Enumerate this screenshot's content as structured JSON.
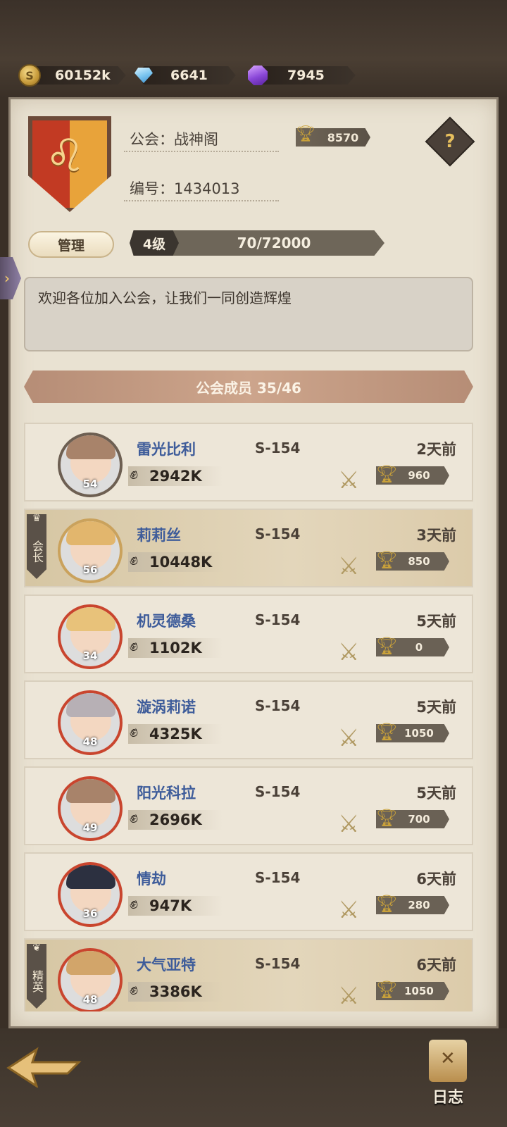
{
  "currency": {
    "gold": "60152k",
    "diamond": "6641",
    "crystal": "7945"
  },
  "guild": {
    "name_label": "公会：战神阁",
    "id_label": "编号：1434013",
    "trophies": "8570",
    "help_symbol": "?",
    "manage_label": "管理",
    "level": "4级",
    "exp": "70/72000",
    "notice": "欢迎各位加入公会，让我们一同创造辉煌"
  },
  "members_header": "公会成员 35/46",
  "members": [
    {
      "name": "雷光比利",
      "server": "S-154",
      "last_seen": "2天前",
      "power": "2942K",
      "trophies": "960",
      "level": "54",
      "badge": "",
      "hair": "#a8836a",
      "ring": "#6d5f52"
    },
    {
      "name": "莉莉丝",
      "server": "S-154",
      "last_seen": "3天前",
      "power": "10448K",
      "trophies": "850",
      "level": "56",
      "badge": "会长",
      "hair": "#e2b66d",
      "ring": "#caa25c"
    },
    {
      "name": "机灵德桑",
      "server": "S-154",
      "last_seen": "5天前",
      "power": "1102K",
      "trophies": "0",
      "level": "34",
      "badge": "",
      "hair": "#e8c27a",
      "ring": "#c9452e"
    },
    {
      "name": "漩涡莉诺",
      "server": "S-154",
      "last_seen": "5天前",
      "power": "4325K",
      "trophies": "1050",
      "level": "48",
      "badge": "",
      "hair": "#b7b0b5",
      "ring": "#c9452e"
    },
    {
      "name": "阳光科拉",
      "server": "S-154",
      "last_seen": "5天前",
      "power": "2696K",
      "trophies": "700",
      "level": "49",
      "badge": "",
      "hair": "#a8836a",
      "ring": "#c9452e"
    },
    {
      "name": "情劫",
      "server": "S-154",
      "last_seen": "6天前",
      "power": "947K",
      "trophies": "280",
      "level": "36",
      "badge": "",
      "hair": "#2c3040",
      "ring": "#c9452e"
    },
    {
      "name": "大气亚特",
      "server": "S-154",
      "last_seen": "6天前",
      "power": "3386K",
      "trophies": "1050",
      "level": "48",
      "badge": "精英",
      "hair": "#d2a56a",
      "ring": "#c9452e"
    }
  ],
  "bottom": {
    "log_label": "日志"
  }
}
